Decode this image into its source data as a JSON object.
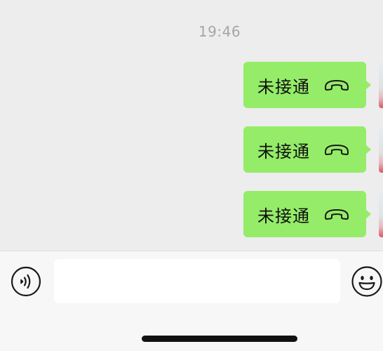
{
  "chat": {
    "timestamp": "19:46",
    "messages": [
      {
        "text": "未接通",
        "icon": "phone-hangup-icon",
        "sender": "self"
      },
      {
        "text": "未接通",
        "icon": "phone-hangup-icon",
        "sender": "self"
      },
      {
        "text": "未接通",
        "icon": "phone-hangup-icon",
        "sender": "self"
      }
    ]
  },
  "input_bar": {
    "voice_icon": "voice-icon",
    "input_value": "",
    "emoji_icon": "emoji-icon"
  },
  "colors": {
    "chat_background": "#ededed",
    "bubble_green": "#95ec69",
    "input_bar_background": "#f7f7f7",
    "timestamp_gray": "#a6a6a6"
  }
}
